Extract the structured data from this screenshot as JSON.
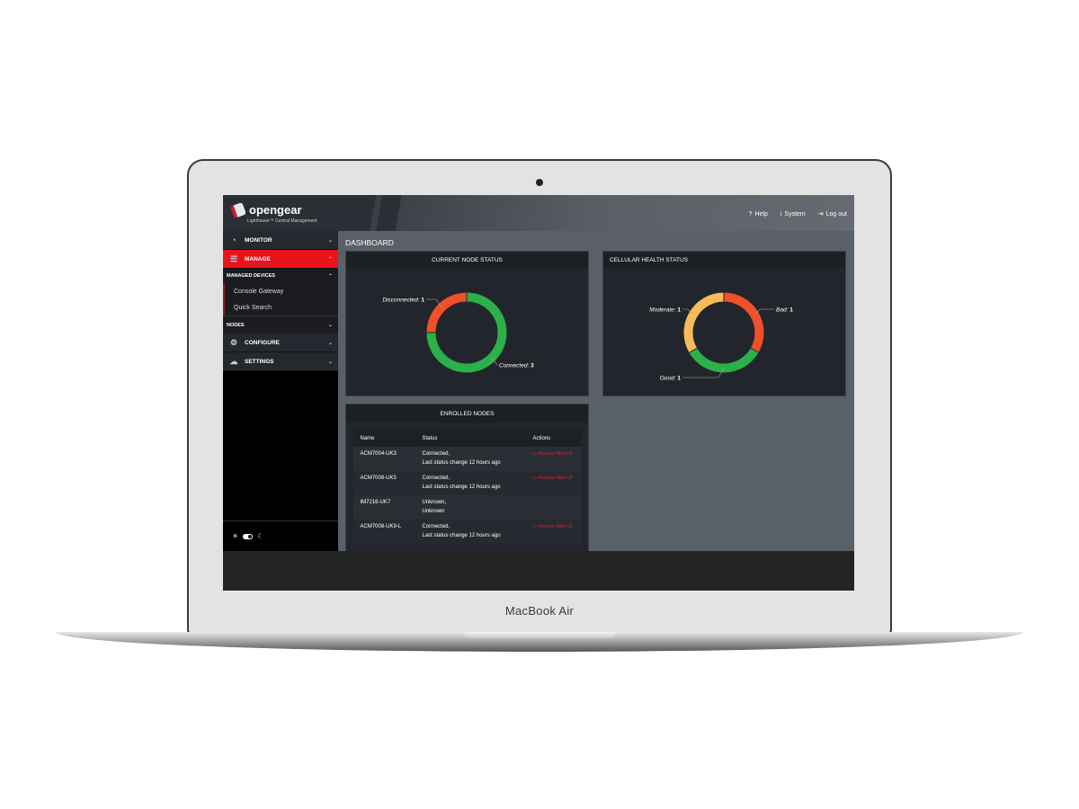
{
  "device": {
    "brand_label": "MacBook Air"
  },
  "app": {
    "logo_text": "opengear",
    "logo_subtitle": "Lighthouse™ Central Management",
    "top_links": [
      {
        "label": "Help",
        "icon": "help-circle-icon",
        "glyph": "?"
      },
      {
        "label": "System",
        "icon": "info-circle-icon",
        "glyph": "i"
      },
      {
        "label": "Log out",
        "icon": "logout-icon",
        "glyph": "⇥"
      }
    ]
  },
  "sidebar": {
    "items": [
      {
        "label": "MONITOR",
        "icon": "gauge-icon",
        "glyph": "◔",
        "expanded": false
      },
      {
        "label": "MANAGE",
        "icon": "devices-icon",
        "glyph": "☰",
        "expanded": true,
        "active": true
      },
      {
        "label": "CONFIGURE",
        "icon": "monitor-config-icon",
        "glyph": "⚙",
        "expanded": false
      },
      {
        "label": "SETTINGS",
        "icon": "settings-icon",
        "glyph": "☁",
        "expanded": false
      }
    ],
    "managed_devices": {
      "label": "MANAGED DEVICES",
      "items": [
        "Console Gateway",
        "Quick Search"
      ]
    },
    "nodes_label": "NODES",
    "theme": {
      "light_glyph": "☀",
      "dark_glyph": "☾",
      "mode": "dark"
    }
  },
  "main": {
    "title": "DASHBOARD",
    "node_status_title": "CURRENT NODE STATUS",
    "cellular_title": "CELLULAR HEALTH STATUS",
    "enrolled": {
      "title": "ENROLLED NODES",
      "columns": [
        "Name",
        "Status",
        "Actions"
      ],
      "rows": [
        {
          "name": "ACM7004-UK3",
          "status1": "Connected,",
          "status2": "Last status change 12 hours ago",
          "action": "Access Web UI"
        },
        {
          "name": "ACM7008-UK5",
          "status1": "Connected,",
          "status2": "Last status change 12 hours ago",
          "action": "Access Web UI"
        },
        {
          "name": "IM7216-UK7",
          "status1": "Unknown,",
          "status2": "Unknown",
          "action": ""
        },
        {
          "name": "ACM7008-UK9-L",
          "status1": "Connected,",
          "status2": "Last status change 12 hours ago",
          "action": "Access Web UI"
        }
      ]
    }
  },
  "chart_data": [
    {
      "type": "pie",
      "title": "CURRENT NODE STATUS",
      "donut": true,
      "categories": [
        "Connected",
        "Disconnected"
      ],
      "values": [
        3,
        1
      ],
      "colors": [
        "#2bb04a",
        "#f0502a"
      ]
    },
    {
      "type": "pie",
      "title": "CELLULAR HEALTH STATUS",
      "donut": true,
      "categories": [
        "Bad",
        "Good",
        "Moderate"
      ],
      "values": [
        1,
        1,
        1
      ],
      "colors": [
        "#f0502a",
        "#2bb04a",
        "#f7bb57"
      ]
    }
  ]
}
